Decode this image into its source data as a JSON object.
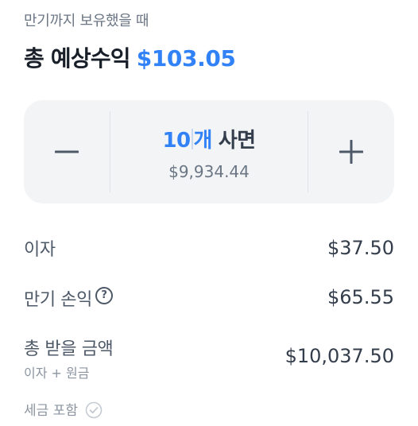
{
  "header": {
    "subtitle": "만기까지 보유했을 때",
    "title": "총 예상수익",
    "amount": "$103.05"
  },
  "stepper": {
    "quantity_first": "10",
    "quantity_rest": "개",
    "suffix": "사면",
    "price": "$9,934.44",
    "minus_icon": "minus-icon",
    "plus_icon": "plus-icon"
  },
  "rows": {
    "interest_label": "이자",
    "interest_value": "$37.50",
    "maturity_label": "만기 손익",
    "maturity_value": "$65.55",
    "total_label": "총 받을 금액",
    "total_sub": "이자 + 원금",
    "total_value": "$10,037.50"
  },
  "tax": {
    "label": "세금 포함",
    "icon": "check-circle-icon"
  },
  "colors": {
    "accent": "#3182f6",
    "panel": "#f2f4f6",
    "text": "#333d4b",
    "muted": "#8b95a1"
  }
}
